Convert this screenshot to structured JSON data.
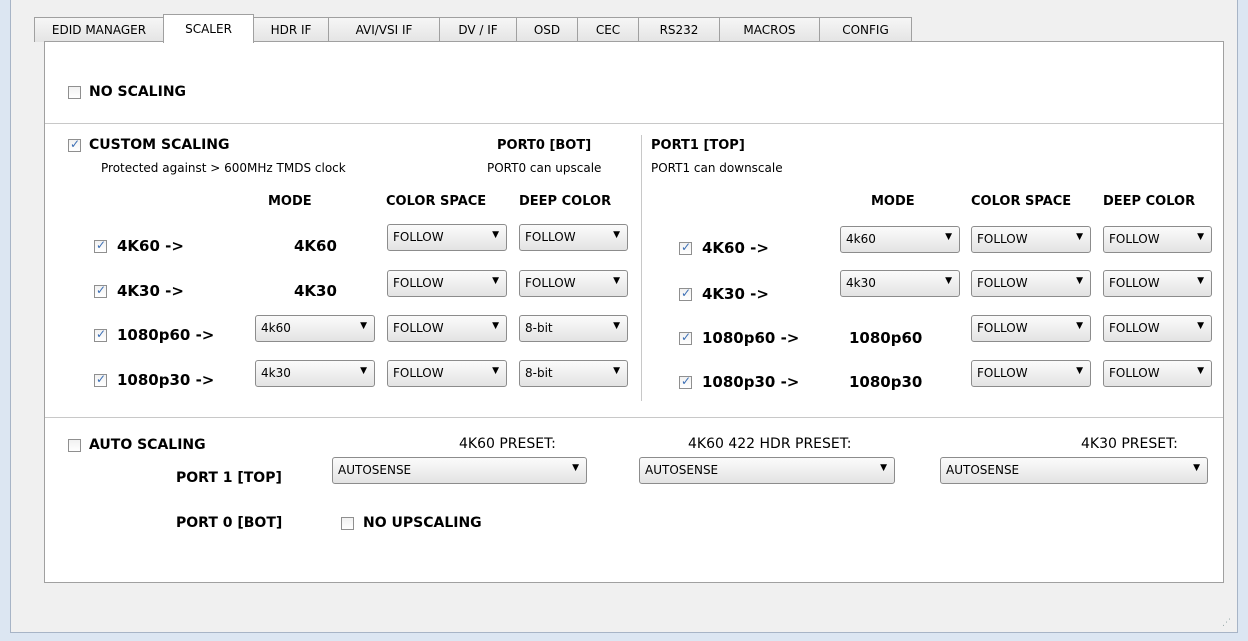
{
  "tabs": [
    {
      "label": "EDID MANAGER",
      "active": false
    },
    {
      "label": "SCALER",
      "active": true
    },
    {
      "label": "HDR IF",
      "active": false
    },
    {
      "label": "AVI/VSI IF",
      "active": false
    },
    {
      "label": "DV / IF",
      "active": false
    },
    {
      "label": "OSD",
      "active": false
    },
    {
      "label": "CEC",
      "active": false
    },
    {
      "label": "RS232",
      "active": false
    },
    {
      "label": "MACROS",
      "active": false
    },
    {
      "label": "CONFIG",
      "active": false
    }
  ],
  "no_scaling": {
    "label": "NO SCALING",
    "checked": false
  },
  "custom_scaling": {
    "label": "CUSTOM SCALING",
    "checked": true,
    "note": "Protected against > 600MHz TMDS clock",
    "port0": {
      "title": "PORT0 [BOT]",
      "note": "PORT0 can upscale",
      "headers": {
        "mode": "MODE",
        "color_space": "COLOR SPACE",
        "deep_color": "DEEP COLOR"
      },
      "rows": [
        {
          "label": "4K60 ->",
          "checked": true,
          "mode": "4K60",
          "mode_dropdown": false,
          "color_space": "FOLLOW",
          "deep_color": "FOLLOW"
        },
        {
          "label": "4K30 ->",
          "checked": true,
          "mode": "4K30",
          "mode_dropdown": false,
          "color_space": "FOLLOW",
          "deep_color": "FOLLOW"
        },
        {
          "label": "1080p60 ->",
          "checked": true,
          "mode": "4k60",
          "mode_dropdown": true,
          "color_space": "FOLLOW",
          "deep_color": "8-bit"
        },
        {
          "label": "1080p30 ->",
          "checked": true,
          "mode": "4k30",
          "mode_dropdown": true,
          "color_space": "FOLLOW",
          "deep_color": "8-bit"
        }
      ]
    },
    "port1": {
      "title": "PORT1 [TOP]",
      "note": "PORT1 can downscale",
      "headers": {
        "mode": "MODE",
        "color_space": "COLOR SPACE",
        "deep_color": "DEEP COLOR"
      },
      "rows": [
        {
          "label": "4K60 ->",
          "checked": true,
          "mode": "4k60",
          "mode_dropdown": true,
          "color_space": "FOLLOW",
          "deep_color": "FOLLOW"
        },
        {
          "label": "4K30 ->",
          "checked": true,
          "mode": "4k30",
          "mode_dropdown": true,
          "color_space": "FOLLOW",
          "deep_color": "FOLLOW"
        },
        {
          "label": "1080p60 ->",
          "checked": true,
          "mode": "1080p60",
          "mode_dropdown": false,
          "color_space": "FOLLOW",
          "deep_color": "FOLLOW"
        },
        {
          "label": "1080p30 ->",
          "checked": true,
          "mode": "1080p30",
          "mode_dropdown": false,
          "color_space": "FOLLOW",
          "deep_color": "FOLLOW"
        }
      ]
    }
  },
  "auto_scaling": {
    "label": "AUTO SCALING",
    "checked": false,
    "port1_label": "PORT 1 [TOP]",
    "port0_label": "PORT 0 [BOT]",
    "preset_4k60_label": "4K60 PRESET:",
    "preset_4k60_value": "AUTOSENSE",
    "preset_4k60_422_label": "4K60 422 HDR PRESET:",
    "preset_4k60_422_value": "AUTOSENSE",
    "preset_4k30_label": "4K30 PRESET:",
    "preset_4k30_value": "AUTOSENSE",
    "no_upscaling_label": "NO UPSCALING",
    "no_upscaling_checked": false
  },
  "icons": {
    "dropdown_arrow": "▼",
    "checkmark": "✓",
    "resize_grip": "⋰"
  }
}
